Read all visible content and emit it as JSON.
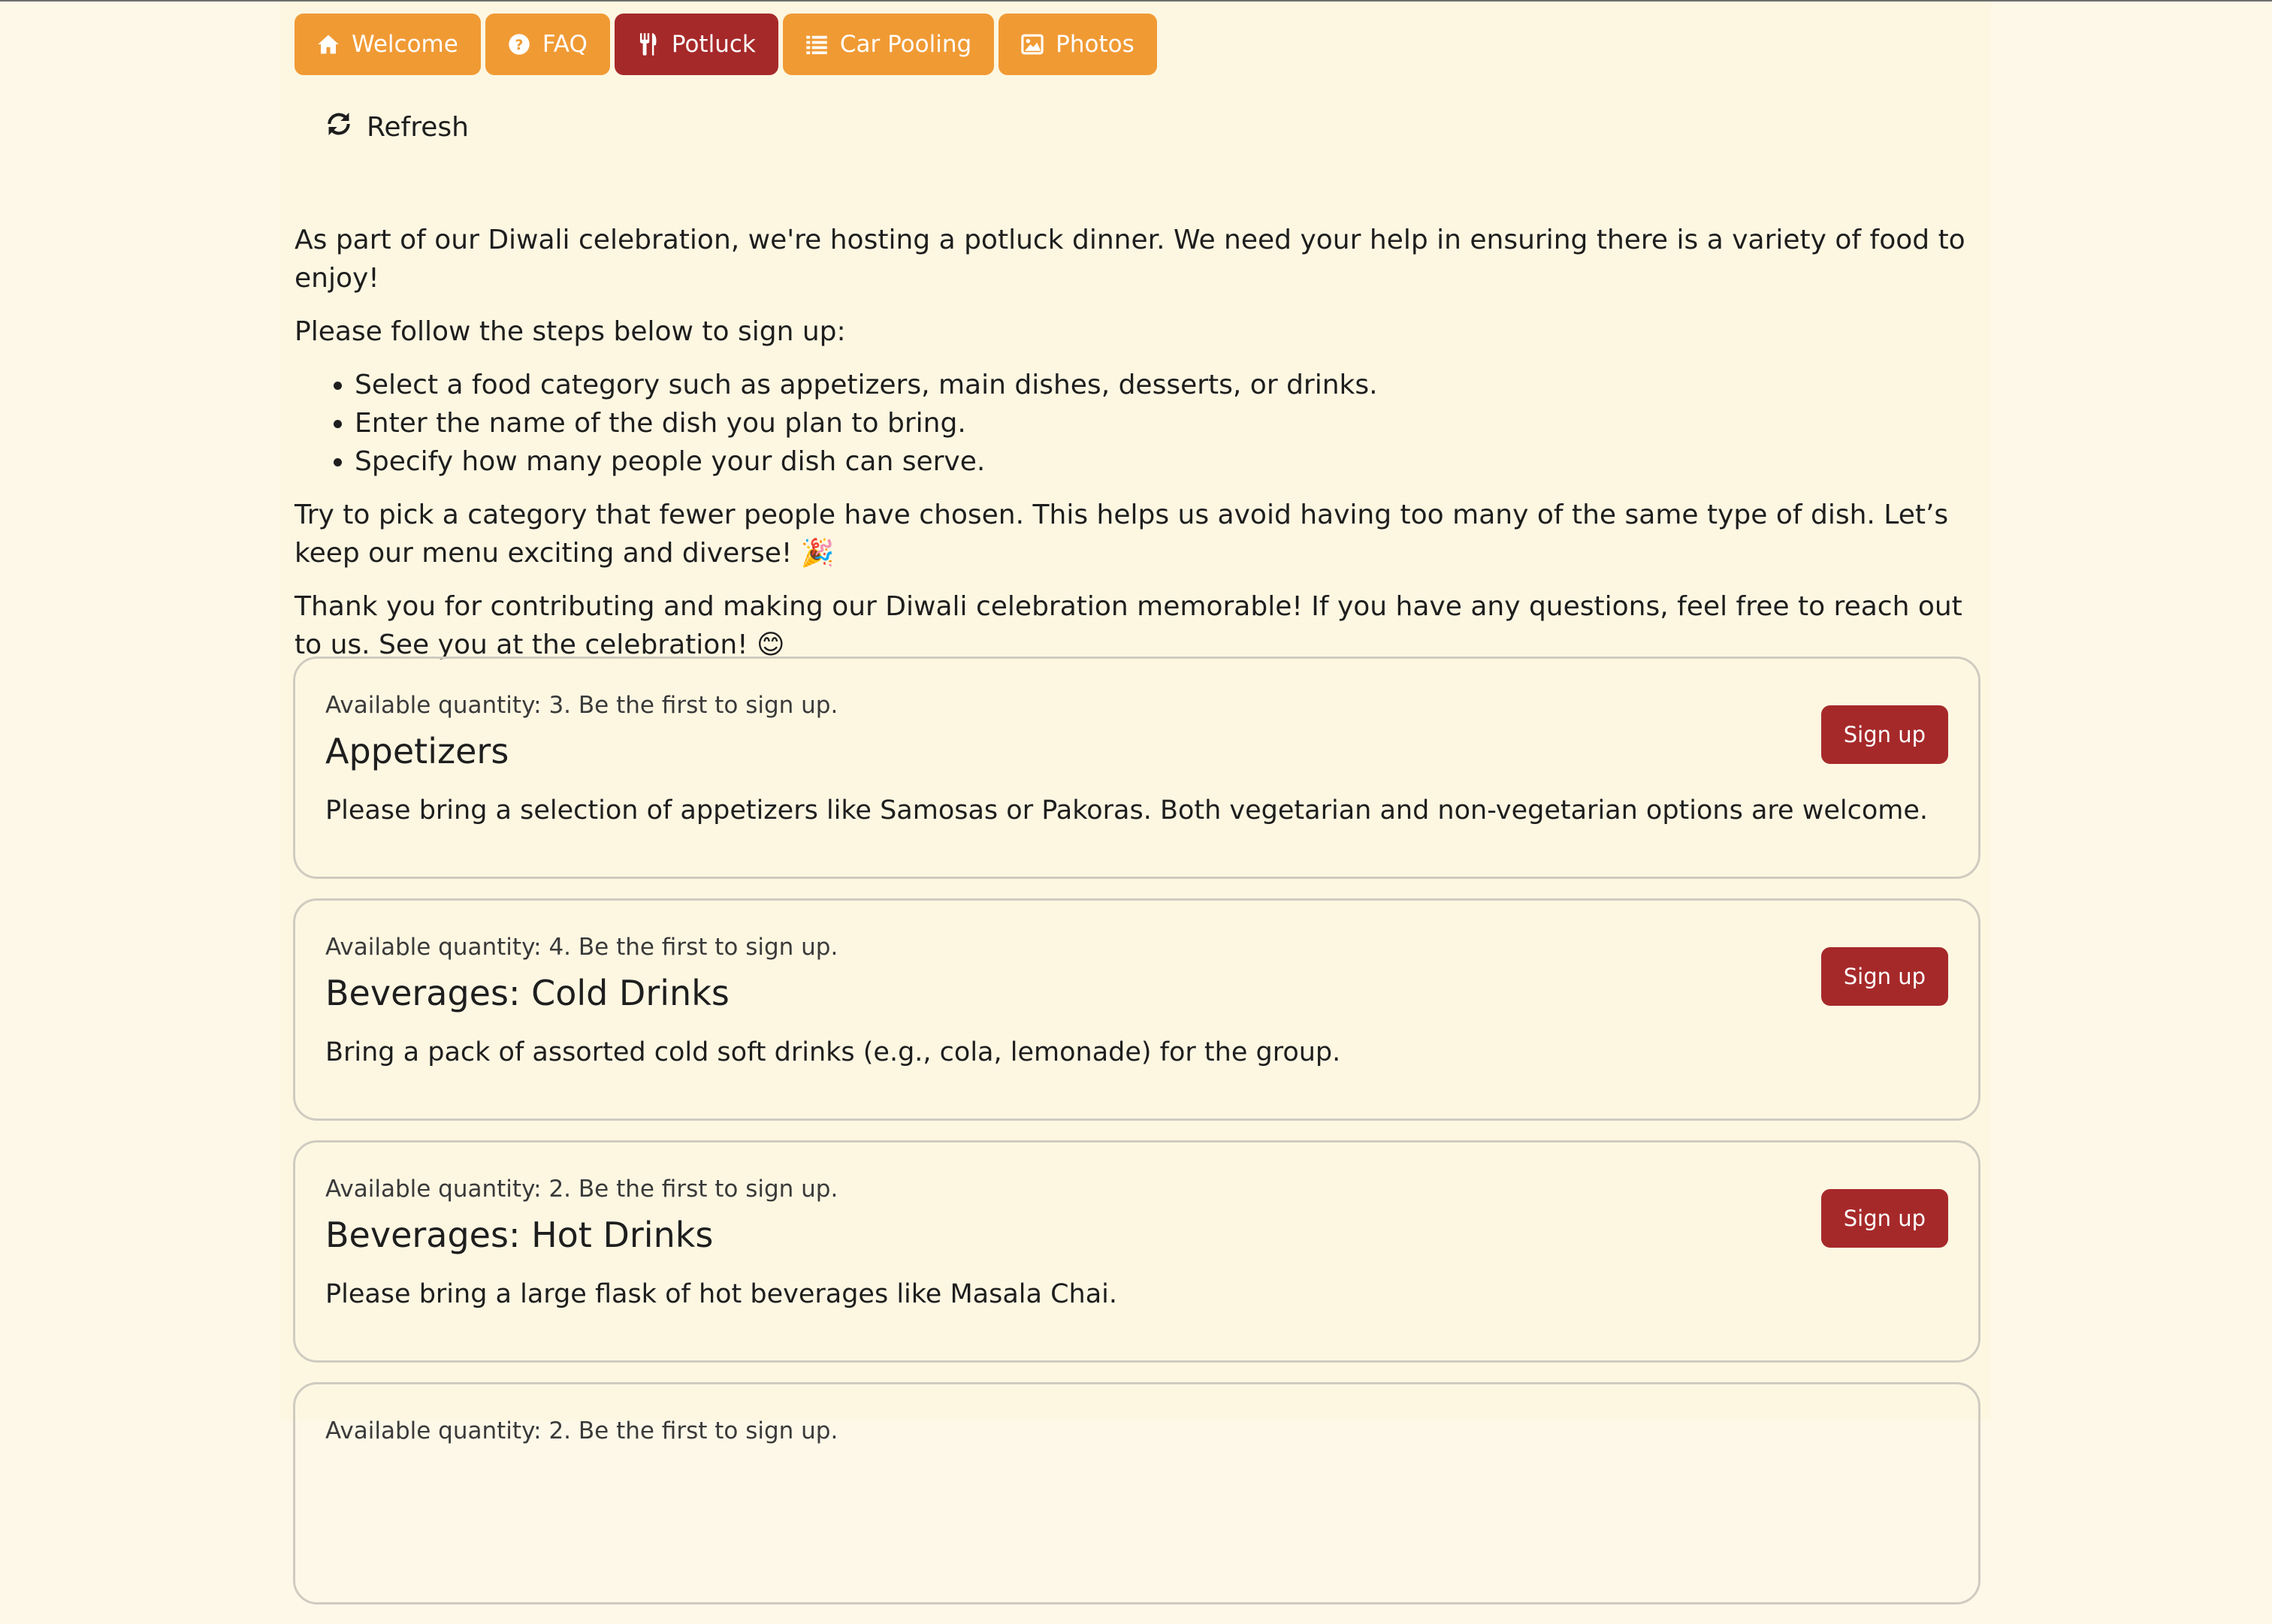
{
  "nav": {
    "tabs": [
      {
        "label": "Welcome",
        "icon": "home-icon"
      },
      {
        "label": "FAQ",
        "icon": "question-circle-icon"
      },
      {
        "label": "Potluck",
        "icon": "utensils-icon",
        "active": true
      },
      {
        "label": "Car Pooling",
        "icon": "list-icon"
      },
      {
        "label": "Photos",
        "icon": "image-icon"
      }
    ]
  },
  "toolbar": {
    "refresh_label": "Refresh"
  },
  "intro": {
    "p1": "As part of our Diwali celebration, we're hosting a potluck dinner. We need your help in ensuring there is a variety of food to enjoy!",
    "p2": "Please follow the steps below to sign up:",
    "steps": [
      "Select a food category such as appetizers, main dishes, desserts, or drinks.",
      "Enter the name of the dish you plan to bring.",
      "Specify how many people your dish can serve."
    ],
    "p3": "Try to pick a category that fewer people have chosen. This helps us avoid having too many of the same type of dish. Let’s keep our menu exciting and diverse! 🎉",
    "p4": "Thank you for contributing and making our Diwali celebration memorable! If you have any questions, feel free to reach out to us. See you at the celebration! 😊"
  },
  "items": [
    {
      "quantity_text": "Available quantity: 3. Be the first to sign up.",
      "title": "Appetizers",
      "description": "Please bring a selection of appetizers like Samosas or Pakoras. Both vegetarian and non-vegetarian options are welcome.",
      "button_label": "Sign up"
    },
    {
      "quantity_text": "Available quantity: 4. Be the first to sign up.",
      "title": "Beverages: Cold Drinks",
      "description": "Bring a pack of assorted cold soft drinks (e.g., cola, lemonade) for the group.",
      "button_label": "Sign up"
    },
    {
      "quantity_text": "Available quantity: 2. Be the first to sign up.",
      "title": "Beverages: Hot Drinks",
      "description": "Please bring a large flask of hot beverages like Masala Chai.",
      "button_label": "Sign up"
    },
    {
      "quantity_text": "Available quantity: 2. Be the first to sign up.",
      "title": "",
      "description": "",
      "button_label": ""
    }
  ],
  "colors": {
    "accent": "#f09a34",
    "active": "#a6292a",
    "background": "#fdf7e2"
  }
}
